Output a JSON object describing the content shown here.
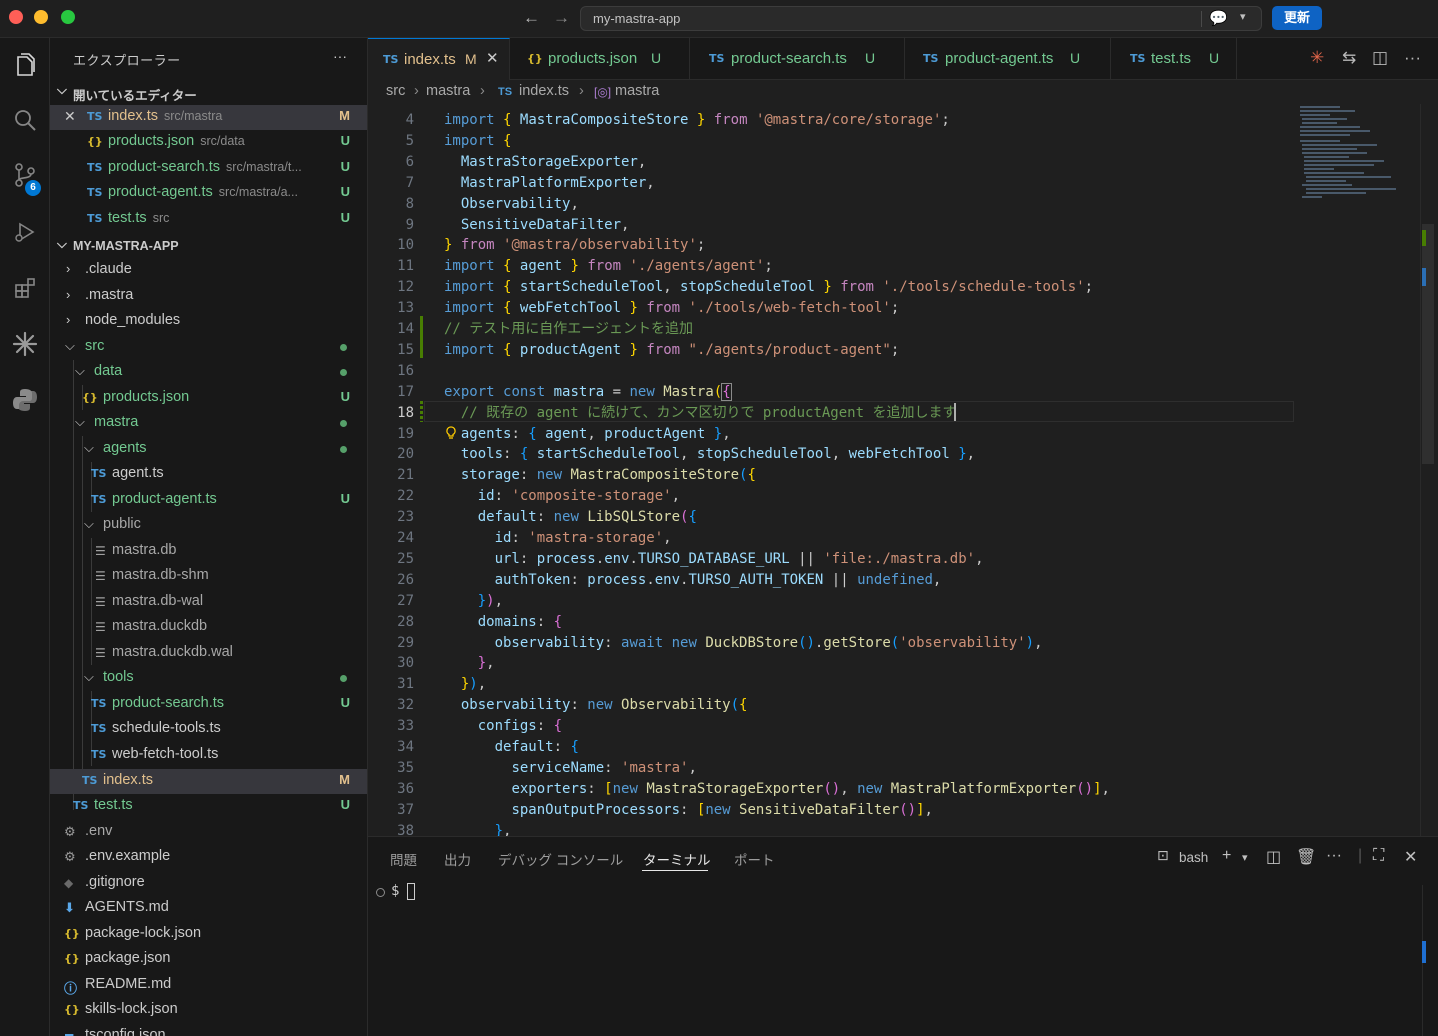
{
  "window": {
    "search_text": "my-mastra-app",
    "update_label": "更新"
  },
  "sidebar": {
    "title": "エクスプローラー",
    "more": "···",
    "open_editors_label": "開いているエディター",
    "open_editors": [
      {
        "name": "index.ts",
        "path": "src/mastra",
        "status": "M",
        "icon": "TS"
      },
      {
        "name": "products.json",
        "path": "src/data",
        "status": "U",
        "icon": "{}"
      },
      {
        "name": "product-search.ts",
        "path": "src/mastra/t...",
        "status": "U",
        "icon": "TS"
      },
      {
        "name": "product-agent.ts",
        "path": "src/mastra/a...",
        "status": "U",
        "icon": "TS"
      },
      {
        "name": "test.ts",
        "path": "src",
        "status": "U",
        "icon": "TS"
      }
    ],
    "project_label": "MY-MASTRA-APP",
    "tree": [
      {
        "name": ".claude"
      },
      {
        "name": ".mastra"
      },
      {
        "name": "node_modules"
      },
      {
        "name": "src"
      },
      {
        "name": "data"
      },
      {
        "name": "products.json",
        "status": "U"
      },
      {
        "name": "mastra"
      },
      {
        "name": "agents"
      },
      {
        "name": "agent.ts"
      },
      {
        "name": "product-agent.ts",
        "status": "U"
      },
      {
        "name": "public"
      },
      {
        "name": "mastra.db"
      },
      {
        "name": "mastra.db-shm"
      },
      {
        "name": "mastra.db-wal"
      },
      {
        "name": "mastra.duckdb"
      },
      {
        "name": "mastra.duckdb.wal"
      },
      {
        "name": "tools"
      },
      {
        "name": "product-search.ts",
        "status": "U"
      },
      {
        "name": "schedule-tools.ts"
      },
      {
        "name": "web-fetch-tool.ts"
      },
      {
        "name": "index.ts",
        "status": "M"
      },
      {
        "name": "test.ts",
        "status": "U"
      },
      {
        "name": ".env"
      },
      {
        "name": ".env.example"
      },
      {
        "name": ".gitignore"
      },
      {
        "name": "AGENTS.md"
      },
      {
        "name": "package-lock.json"
      },
      {
        "name": "package.json"
      },
      {
        "name": "README.md"
      },
      {
        "name": "skills-lock.json"
      },
      {
        "name": "tsconfig.json"
      }
    ]
  },
  "activity": {
    "scm_badge": "6"
  },
  "tabs": [
    {
      "name": "index.ts",
      "status": "M",
      "icon": "TS"
    },
    {
      "name": "products.json",
      "status": "U",
      "icon": "{}"
    },
    {
      "name": "product-search.ts",
      "status": "U",
      "icon": "TS"
    },
    {
      "name": "product-agent.ts",
      "status": "U",
      "icon": "TS"
    },
    {
      "name": "test.ts",
      "status": "U",
      "icon": "TS"
    }
  ],
  "breadcrumb": {
    "p1": "src",
    "p2": "mastra",
    "p3": "index.ts",
    "p4": "mastra",
    "ts": "TS"
  },
  "editor": {
    "line_numbers": [
      "4",
      "5",
      "6",
      "7",
      "8",
      "9",
      "10",
      "11",
      "12",
      "13",
      "14",
      "15",
      "16",
      "17",
      "18",
      "19",
      "20",
      "21",
      "22",
      "23",
      "24",
      "25",
      "26",
      "27",
      "28",
      "29",
      "30",
      "31",
      "32",
      "33",
      "34",
      "35",
      "36",
      "37",
      "38"
    ],
    "current_line": "18"
  },
  "panel": {
    "tabs": [
      "問題",
      "出力",
      "デバッグ コンソール",
      "ターミナル",
      "ポート"
    ],
    "active_tab": "ターミナル",
    "shell": "bash",
    "prompt": "$"
  },
  "colors": {
    "accent": "#0078d4",
    "modified": "#e2c08d",
    "untracked": "#73c991"
  }
}
